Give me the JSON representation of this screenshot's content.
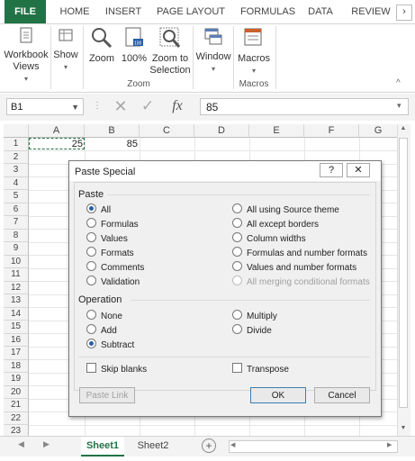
{
  "ribbon_tabs": [
    "FILE",
    "HOME",
    "INSERT",
    "PAGE LAYOUT",
    "FORMULAS",
    "DATA",
    "REVIEW"
  ],
  "ribbon": {
    "workbook_views": "Workbook\nViews",
    "show": "Show",
    "zoom": "Zoom",
    "zoom100": "100%",
    "zoom_to_selection": "Zoom to\nSelection",
    "window": "Window",
    "macros": "Macros",
    "group_zoom": "Zoom",
    "group_macros": "Macros"
  },
  "formula_bar": {
    "name_box": "B1",
    "formula": "85"
  },
  "columns": [
    "A",
    "B",
    "C",
    "D",
    "E",
    "F",
    "G"
  ],
  "rows": [
    "1",
    "2",
    "3",
    "4",
    "5",
    "6",
    "7",
    "8",
    "9",
    "10",
    "11",
    "12",
    "13",
    "14",
    "15",
    "16",
    "17",
    "18",
    "19",
    "20",
    "21",
    "22",
    "23"
  ],
  "cells": {
    "A1": "25",
    "B1": "85"
  },
  "sheets": [
    "Sheet1",
    "Sheet2"
  ],
  "dialog": {
    "title": "Paste Special",
    "help_button": "?",
    "paste_section": "Paste",
    "paste_left": [
      "All",
      "Formulas",
      "Values",
      "Formats",
      "Comments",
      "Validation"
    ],
    "paste_right": [
      "All using Source theme",
      "All except borders",
      "Column widths",
      "Formulas and number formats",
      "Values and number formats",
      "All merging conditional formats"
    ],
    "operation_section": "Operation",
    "op_left": [
      "None",
      "Add",
      "Subtract"
    ],
    "op_right": [
      "Multiply",
      "Divide"
    ],
    "skip_blanks": "Skip blanks",
    "transpose": "Transpose",
    "paste_link": "Paste Link",
    "ok": "OK",
    "cancel": "Cancel"
  },
  "colors": {
    "excel_green": "#217346",
    "radio_selected": "#2a5ea8"
  }
}
